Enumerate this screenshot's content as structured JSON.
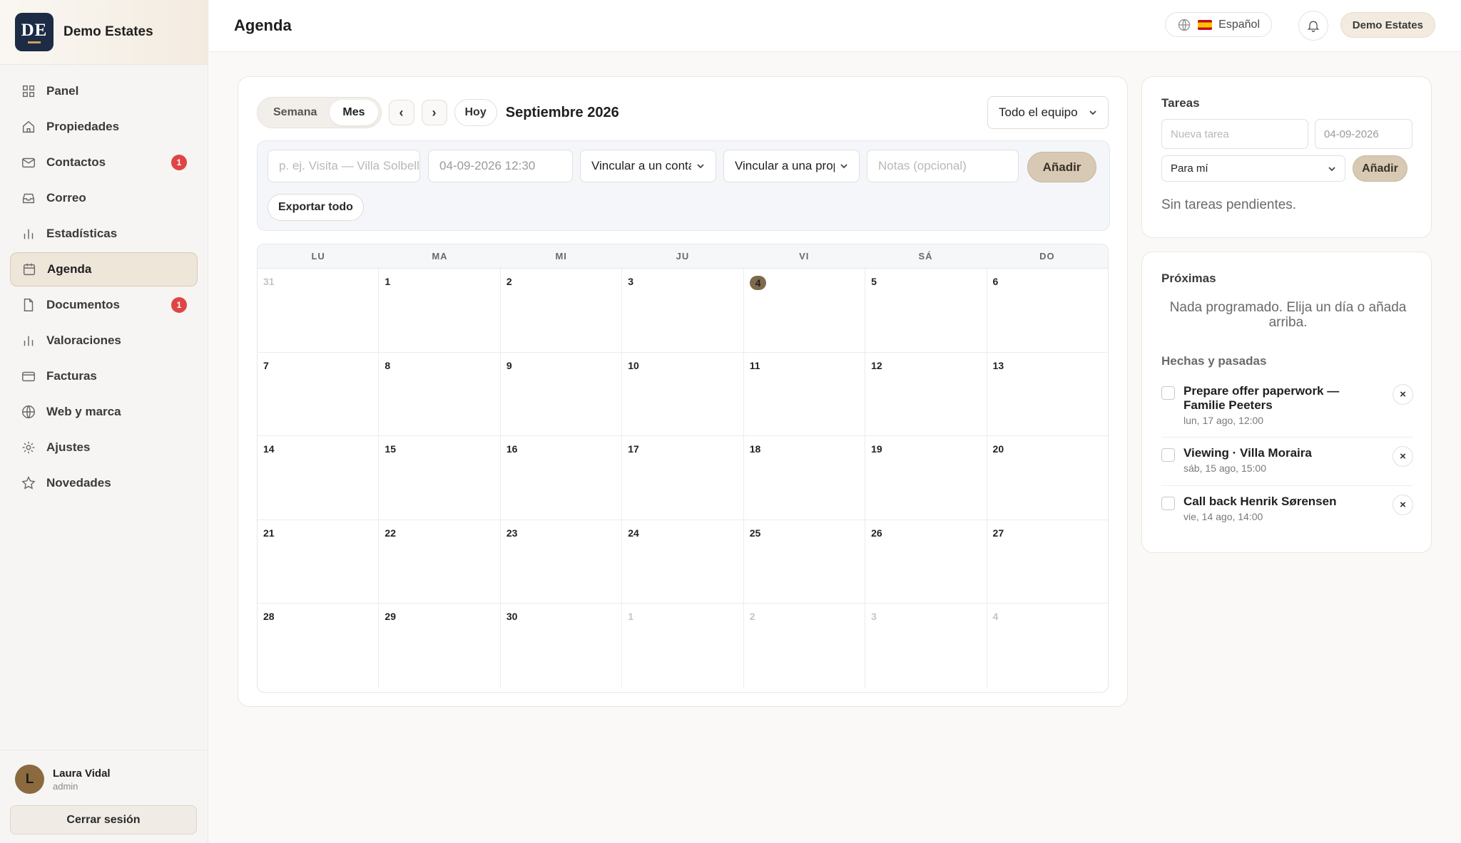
{
  "brand": {
    "logo_text": "DE",
    "name": "Demo Estates"
  },
  "nav": [
    {
      "label": "Panel",
      "icon": "grid-icon",
      "badge": ""
    },
    {
      "label": "Propiedades",
      "icon": "home-icon",
      "badge": ""
    },
    {
      "label": "Contactos",
      "icon": "mail-icon",
      "badge": "1"
    },
    {
      "label": "Correo",
      "icon": "inbox-icon",
      "badge": ""
    },
    {
      "label": "Estadísticas",
      "icon": "bar-chart-icon",
      "badge": ""
    },
    {
      "label": "Agenda",
      "icon": "calendar-icon",
      "badge": "",
      "active": true
    },
    {
      "label": "Documentos",
      "icon": "document-icon",
      "badge": "1"
    },
    {
      "label": "Valoraciones",
      "icon": "bar-chart-icon",
      "badge": ""
    },
    {
      "label": "Facturas",
      "icon": "credit-card-icon",
      "badge": ""
    },
    {
      "label": "Web y marca",
      "icon": "globe-icon",
      "badge": ""
    },
    {
      "label": "Ajustes",
      "icon": "gear-icon",
      "badge": ""
    },
    {
      "label": "Novedades",
      "icon": "star-icon",
      "badge": ""
    }
  ],
  "user": {
    "initial": "L",
    "name": "Laura Vidal",
    "role": "admin",
    "logout_label": "Cerrar sesión"
  },
  "header": {
    "title": "Agenda",
    "language": "Español",
    "account": "Demo Estates"
  },
  "calendar": {
    "view_week": "Semana",
    "view_month": "Mes",
    "prev": "‹",
    "next": "›",
    "today": "Hoy",
    "month_title": "Septiembre 2026",
    "team_filter": "Todo el equipo",
    "form": {
      "title_placeholder": "p. ej. Visita — Villa Solbella",
      "datetime": "04-09-2026 12:30",
      "link_contact": "Vincular a un contacto",
      "link_property": "Vincular a una propiedad",
      "notes_placeholder": "Notas (opcional)",
      "add_label": "Añadir",
      "export_label": "Exportar todo"
    },
    "weekdays": [
      "LU",
      "MA",
      "MI",
      "JU",
      "VI",
      "SÁ",
      "DO"
    ],
    "weeks": [
      [
        {
          "d": "31",
          "m": true
        },
        {
          "d": "1"
        },
        {
          "d": "2"
        },
        {
          "d": "3"
        },
        {
          "d": "4",
          "today": true
        },
        {
          "d": "5"
        },
        {
          "d": "6"
        }
      ],
      [
        {
          "d": "7"
        },
        {
          "d": "8"
        },
        {
          "d": "9"
        },
        {
          "d": "10"
        },
        {
          "d": "11"
        },
        {
          "d": "12"
        },
        {
          "d": "13"
        }
      ],
      [
        {
          "d": "14"
        },
        {
          "d": "15"
        },
        {
          "d": "16"
        },
        {
          "d": "17"
        },
        {
          "d": "18"
        },
        {
          "d": "19"
        },
        {
          "d": "20"
        }
      ],
      [
        {
          "d": "21"
        },
        {
          "d": "22"
        },
        {
          "d": "23"
        },
        {
          "d": "24"
        },
        {
          "d": "25"
        },
        {
          "d": "26"
        },
        {
          "d": "27"
        }
      ],
      [
        {
          "d": "28"
        },
        {
          "d": "29"
        },
        {
          "d": "30"
        },
        {
          "d": "1",
          "m": true
        },
        {
          "d": "2",
          "m": true
        },
        {
          "d": "3",
          "m": true
        },
        {
          "d": "4",
          "m": true
        }
      ]
    ]
  },
  "tasks": {
    "title": "Tareas",
    "new_placeholder": "Nueva tarea",
    "date_placeholder": "04-09-2026",
    "assign": "Para mí",
    "add_label": "Añadir",
    "empty": "Sin tareas pendientes."
  },
  "upcoming": {
    "title": "Próximas",
    "empty": "Nada programado. Elija un día o añada arriba.",
    "done_title": "Hechas y pasadas",
    "items": [
      {
        "title": "Prepare offer paperwork — Familie Peeters",
        "when": "lun, 17 ago, 12:00"
      },
      {
        "title": "Viewing · Villa Moraira",
        "when": "sáb, 15 ago, 15:00"
      },
      {
        "title": "Call back Henrik Sørensen",
        "when": "vie, 14 ago, 14:00"
      }
    ]
  }
}
